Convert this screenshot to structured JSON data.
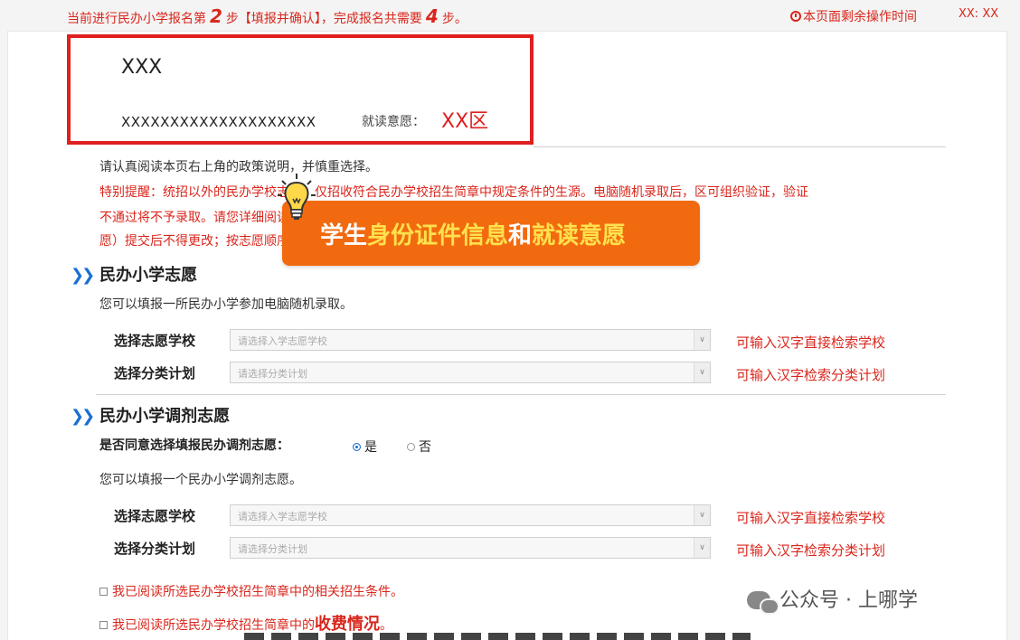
{
  "header": {
    "step_prefix": "当前进行民办小学报名第",
    "step_current": "2",
    "step_mid": "步【填报并确认】，完成报名共需要",
    "step_total": "4",
    "step_suffix": "步。",
    "timer_label": "本页面剩余操作时间",
    "timer_value": "XX: XX"
  },
  "identity": {
    "name": "XXX",
    "id_number": "XXXXXXXXXXXXXXXXXXXX",
    "intent_label": "就读意愿：",
    "intent_value": "XX区"
  },
  "notice": {
    "line1": "请认真阅读本页右上角的政策说明，并慎重选择。",
    "line2": "特别提醒：统招以外的民办学校志愿，仅招收符合民办学校招生简章中规定条件的生源。电脑随机录取后，区可组织验证，验证",
    "line3": "不通过将不予录取。请您详细阅读招生简章的相关内容后填报。民办学校志愿（含报名志愿和调剂志",
    "line4": "愿）提交后不得更改；按志愿顺序录取。"
  },
  "callout": {
    "part1": "学生",
    "part2": "身份证件信息",
    "part3": "和",
    "part4": "就读意愿"
  },
  "section1": {
    "title": "民办小学志愿",
    "hint": "您可以填报一所民办小学参加电脑随机录取。",
    "school_label": "选择志愿学校",
    "school_placeholder": "请选择入学志愿学校",
    "school_tip": "可输入汉字直接检索学校",
    "plan_label": "选择分类计划",
    "plan_placeholder": "请选择分类计划",
    "plan_tip": "可输入汉字检索分类计划"
  },
  "section2": {
    "title": "民办小学调剂志愿",
    "question": "是否同意选择填报民办调剂志愿：",
    "yes": "是",
    "no": "否",
    "hint": "您可以填报一个民办小学调剂志愿。",
    "school_label": "选择志愿学校",
    "school_placeholder": "请选择入学志愿学校",
    "school_tip": "可输入汉字直接检索学校",
    "plan_label": "选择分类计划",
    "plan_placeholder": "请选择分类计划",
    "plan_tip": "可输入汉字检索分类计划"
  },
  "checks": {
    "c1": "我已阅读所选民办学校招生简章中的相关招生条件。",
    "c2_prefix": "我已阅读所选民办学校招生简章中的",
    "c2_strong": "收费情况",
    "c2_suffix": "。"
  },
  "watermark": {
    "text": "公众号 · 上哪学"
  },
  "colors": {
    "accent_red": "#d9261c",
    "callout_orange": "#f26a0f",
    "callout_highlight": "#ffe14d",
    "link_blue": "#1a6fd1"
  }
}
